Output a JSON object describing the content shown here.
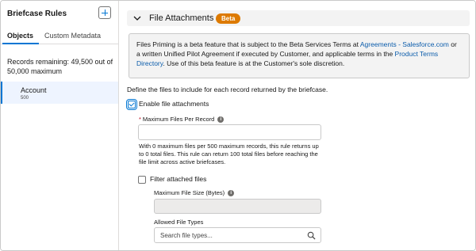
{
  "left": {
    "title": "Briefcase Rules",
    "add_icon": "plus-icon",
    "tabs": [
      {
        "label": "Objects",
        "active": true
      },
      {
        "label": "Custom Metadata",
        "active": false
      }
    ],
    "records_remaining": "Records remaining: 49,500 out of 50,000 maximum",
    "objects": [
      {
        "name": "Account",
        "count": "500",
        "selected": true
      }
    ]
  },
  "section": {
    "chevron_icon": "chevron-down-icon",
    "title": "File Attachments",
    "badge": "Beta",
    "badge_color": "#dd7a01"
  },
  "info": {
    "text_1": "Files Priming is a beta feature that is subject to the Beta Services Terms at ",
    "link_1": "Agreements - Salesforce.com",
    "text_2": " or a written Unified Pilot Agreement if executed by Customer, and applicable terms in the ",
    "link_2": "Product Terms Directory",
    "text_3": ". Use of this beta feature is at the Customer's sole discretion."
  },
  "form": {
    "define_text": "Define the files to include for each record returned by the briefcase.",
    "enable_label": "Enable file attachments",
    "enable_checked": true,
    "max_files_required": "*",
    "max_files_label": "Maximum Files Per Record",
    "max_files_value": "",
    "help_text": "With 0 maximum files per 500 maximum records, this rule returns up to 0 total files. This rule can return 100 total files before reaching the file limit across active briefcases.",
    "filter_label": "Filter attached files",
    "filter_checked": false,
    "max_size_label": "Maximum File Size (Bytes)",
    "max_size_value": "",
    "allowed_types_label": "Allowed File Types",
    "allowed_types_placeholder": "Search file types...",
    "info_icon": "info-icon",
    "search_icon": "search-icon"
  },
  "colors": {
    "accent": "#0176d3",
    "link": "#0b5cab",
    "required": "#ba0517"
  }
}
